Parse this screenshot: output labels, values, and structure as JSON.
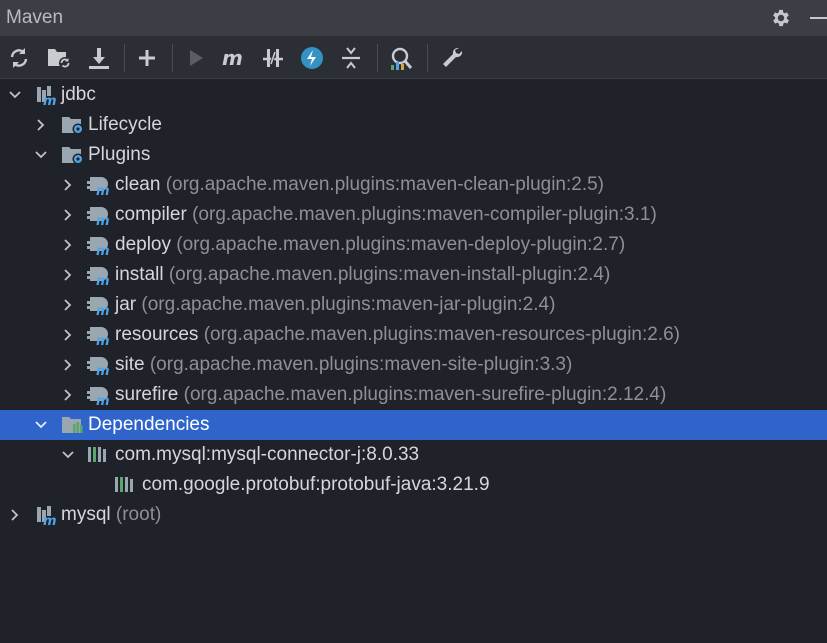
{
  "panel": {
    "title": "Maven"
  },
  "toolbar": {
    "buttons": [
      {
        "name": "reload-all-icon"
      },
      {
        "name": "reload-project-icon"
      },
      {
        "name": "download-sources-icon"
      },
      {
        "name": "add-project-icon"
      },
      {
        "name": "run-icon"
      },
      {
        "name": "execute-goal-icon"
      },
      {
        "name": "toggle-offline-icon"
      },
      {
        "name": "skip-tests-icon"
      },
      {
        "name": "collapse-all-icon"
      },
      {
        "name": "analyze-dependencies-icon"
      },
      {
        "name": "settings-wrench-icon"
      }
    ]
  },
  "tree": {
    "project1": {
      "name": "jdbc"
    },
    "lifecycle": {
      "label": "Lifecycle"
    },
    "plugins": {
      "label": "Plugins",
      "items": [
        {
          "name": "clean",
          "detail": "(org.apache.maven.plugins:maven-clean-plugin:2.5)"
        },
        {
          "name": "compiler",
          "detail": "(org.apache.maven.plugins:maven-compiler-plugin:3.1)"
        },
        {
          "name": "deploy",
          "detail": "(org.apache.maven.plugins:maven-deploy-plugin:2.7)"
        },
        {
          "name": "install",
          "detail": "(org.apache.maven.plugins:maven-install-plugin:2.4)"
        },
        {
          "name": "jar",
          "detail": "(org.apache.maven.plugins:maven-jar-plugin:2.4)"
        },
        {
          "name": "resources",
          "detail": "(org.apache.maven.plugins:maven-resources-plugin:2.6)"
        },
        {
          "name": "site",
          "detail": "(org.apache.maven.plugins:maven-site-plugin:3.3)"
        },
        {
          "name": "surefire",
          "detail": "(org.apache.maven.plugins:maven-surefire-plugin:2.12.4)"
        }
      ]
    },
    "dependencies": {
      "label": "Dependencies",
      "items": [
        {
          "name": "com.mysql:mysql-connector-j:8.0.33"
        },
        {
          "name": "com.google.protobuf:protobuf-java:3.21.9"
        }
      ]
    },
    "project2": {
      "name": "mysql",
      "detail": "(root)"
    }
  },
  "colors": {
    "selection": "#2f65ca",
    "maven_m": "#4fa3e6",
    "library_green": "#59a869"
  }
}
